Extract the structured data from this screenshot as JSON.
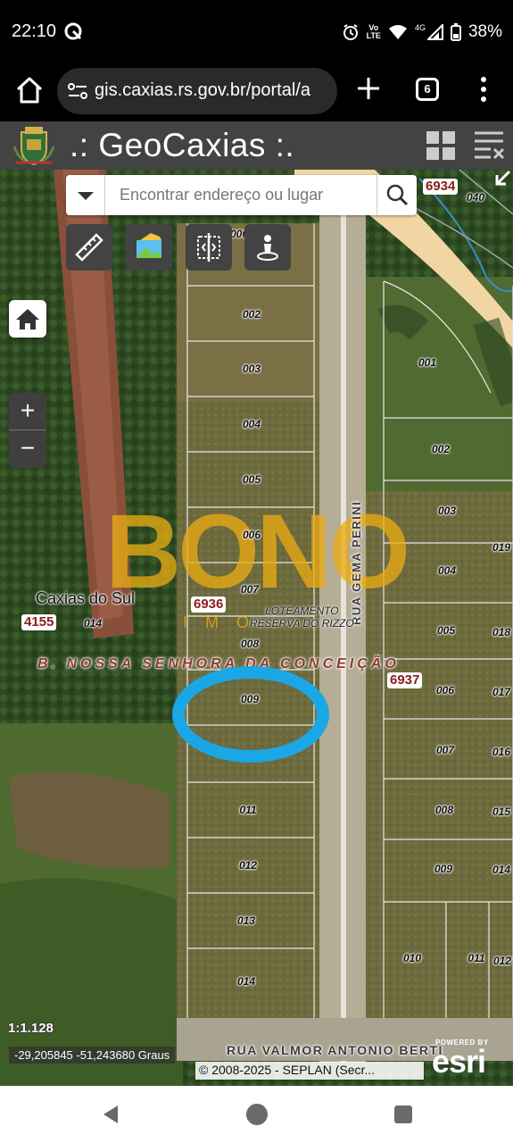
{
  "status_bar": {
    "time": "22:10",
    "volte": "Vo\nLTE",
    "network": "4G",
    "battery": "38%"
  },
  "browser": {
    "url": "gis.caxias.rs.gov.br/portal/a",
    "tab_count": "6"
  },
  "app": {
    "title": ".: GeoCaxias :."
  },
  "search": {
    "placeholder": "Encontrar endereço ou lugar"
  },
  "map": {
    "street_perini": "RUA GEMA PERINI",
    "street_valmor": "RUA VALMOR ANTONIO BERTI",
    "neighborhood": "B. NOSSA SENHORA DA CONCEIÇÃO",
    "loteamento_line1": "LOTEAMENTO",
    "loteamento_line2": "RESERVA DO RIZZO",
    "city": "Caxias do Sul",
    "blocks": {
      "b6934": "6934",
      "b6936": "6936",
      "b4155": "4155",
      "b6937": "6937"
    },
    "lots_left": [
      "006",
      "002",
      "003",
      "004",
      "005",
      "006",
      "007",
      "008",
      "009",
      "011",
      "012",
      "013",
      "014"
    ],
    "lots_right": [
      "001",
      "002",
      "003",
      "004",
      "005",
      "006",
      "007",
      "008",
      "009",
      "010",
      "011"
    ],
    "lots_right_edge": [
      "019",
      "018",
      "017",
      "016",
      "015",
      "014",
      "012"
    ],
    "lots_misc": {
      "l040": "040",
      "l014": "014"
    },
    "watermark": "BONO",
    "watermark_sub": "IMO",
    "scale": "1:1.128",
    "coordinates": "-29,205845 -51,243680 Graus",
    "copyright": "© 2008-2025 - SEPLAN (Secr...",
    "esri_powered": "POWERED BY",
    "esri": "esri"
  },
  "colors": {
    "header_bg": "#434343",
    "highlight": "#1aa7e6",
    "block_label": "#8b1c1c",
    "watermark": "#e8aa14"
  }
}
